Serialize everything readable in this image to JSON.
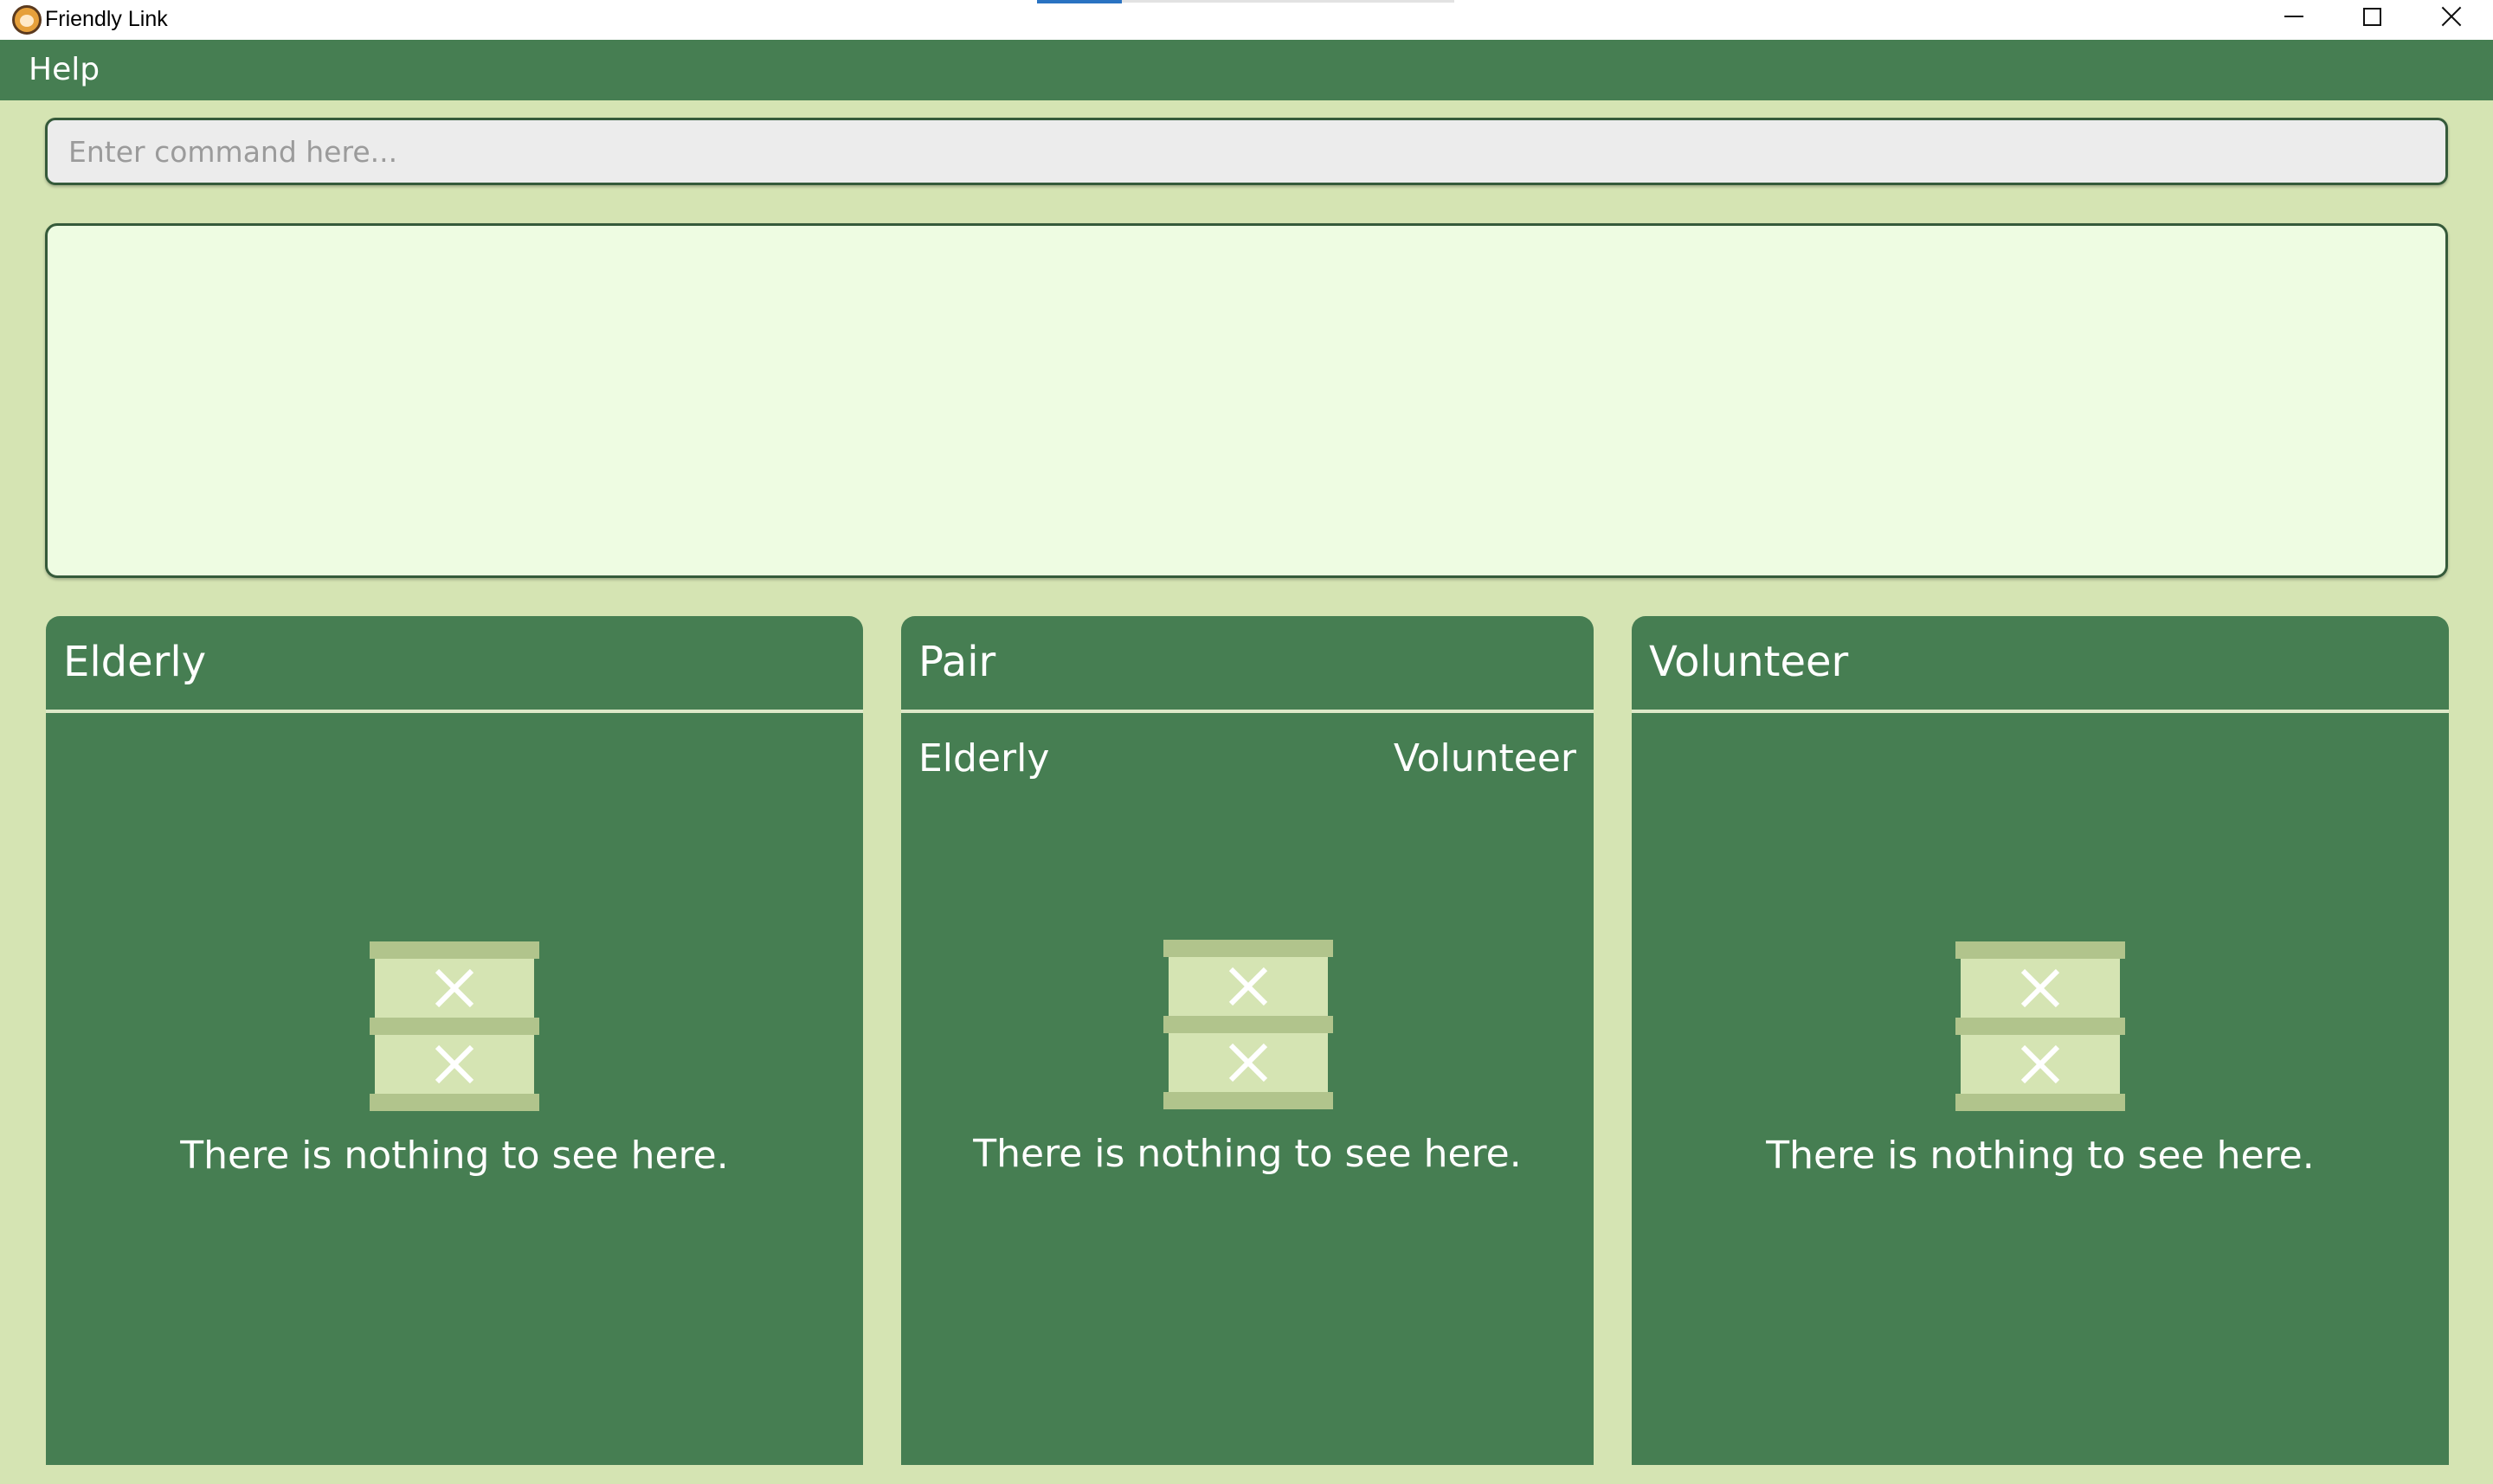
{
  "window": {
    "title": "Friendly Link"
  },
  "menu": {
    "help_label": "Help"
  },
  "command": {
    "placeholder": "Enter command here...",
    "value": ""
  },
  "result": {
    "text": ""
  },
  "panels": {
    "elderly": {
      "title": "Elderly",
      "empty_text": "There is nothing to see here."
    },
    "pair": {
      "title": "Pair",
      "col_left": "Elderly",
      "col_right": "Volunteer",
      "empty_text": "There is nothing to see here."
    },
    "volunteer": {
      "title": "Volunteer",
      "empty_text": "There is nothing to see here."
    }
  },
  "icons": {
    "app": "friendly-link-logo-icon",
    "empty": "empty-box-icon"
  },
  "colors": {
    "background": "#d5e4b3",
    "panel": "#467e52",
    "result_bg": "#eefce2",
    "command_bg": "#ececec"
  }
}
